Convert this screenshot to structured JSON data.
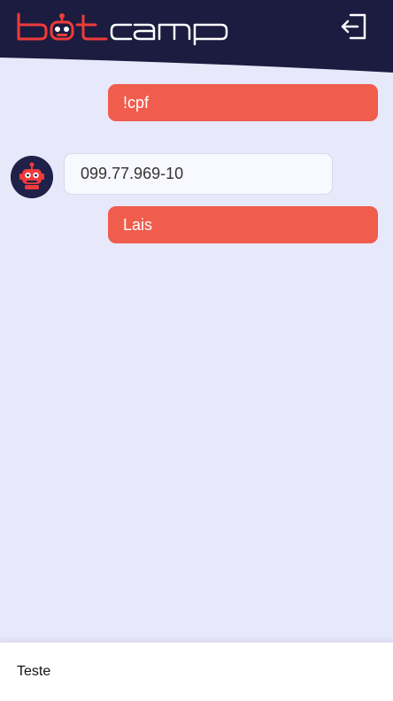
{
  "header": {
    "logo_text": "botcamp",
    "logout_icon": "logout-icon",
    "colors": {
      "bg": "#1b1c3f",
      "logo_accent": "#ef3b3b",
      "logo_text": "#ffffff"
    }
  },
  "messages": [
    {
      "sender": "user",
      "text": "!cpf"
    },
    {
      "sender": "bot",
      "text": "099.77.969-10",
      "avatar_icon": "robot-icon"
    },
    {
      "sender": "user",
      "text": "Lais"
    }
  ],
  "composer": {
    "value": "Teste",
    "placeholder": ""
  },
  "colors": {
    "page_bg": "#e8e8fb",
    "user_bubble": "#f05d4d",
    "bot_bubble": "#f8f8ff"
  }
}
